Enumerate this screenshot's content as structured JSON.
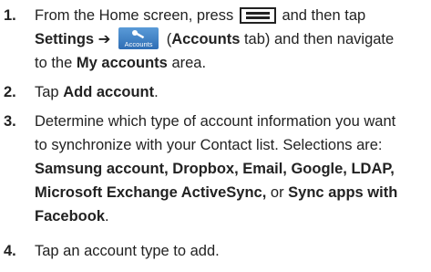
{
  "steps": [
    {
      "number": "1.",
      "part1": "From the Home screen, press",
      "part2": "and then tap",
      "settings_arrow": "Settings ➔",
      "accounts_icon_label": "Accounts",
      "accounts_tab": "Accounts",
      "paren_open": "(",
      "tab_suffix": "tab) and then navigate",
      "line3_pre": "to the",
      "my_accounts": "My accounts",
      "line3_post": "area."
    },
    {
      "number": "2.",
      "pre": "Tap",
      "bold": "Add account",
      "post": "."
    },
    {
      "number": "3.",
      "line1": "Determine which type of account information you want",
      "line2": "to synchronize with your Contact list. Selections are:",
      "line3_bold": "Samsung account, Dropbox, Email, Google, LDAP,",
      "line4_bold": "Microsoft Exchange ActiveSync,",
      "line4_or": "or",
      "line4_bold2": "Sync apps with",
      "line5_bold": "Facebook",
      "line5_post": "."
    },
    {
      "number": "4.",
      "text": "Tap an account type to add."
    }
  ],
  "icons": {
    "menu": "menu-key-icon",
    "accounts": "accounts-tab-icon"
  },
  "colors": {
    "text": "#222222",
    "icon_blue_top": "#5a9bd8",
    "icon_blue_bottom": "#2f6eb5"
  }
}
